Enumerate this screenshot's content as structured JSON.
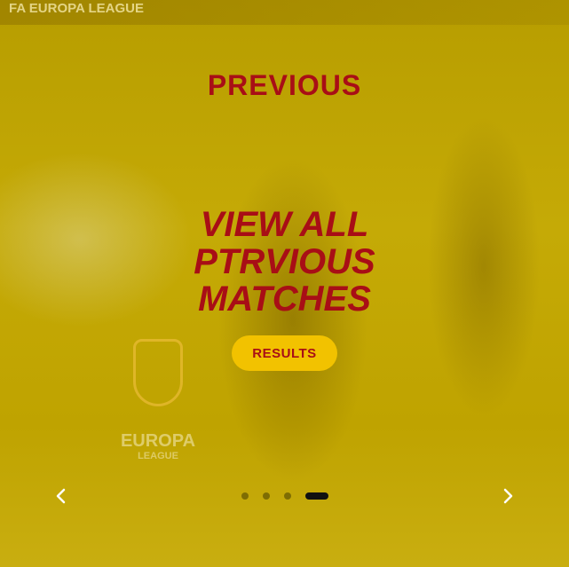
{
  "banner": {
    "text": "FA EUROPA LEAGUE"
  },
  "logo": {
    "word": "EUROPA",
    "sub": "LEAGUE"
  },
  "section": {
    "title": "PREVIOUS"
  },
  "headline": {
    "line1": "VIEW ALL",
    "line2": "PTRVIOUS",
    "line3": "MATCHES"
  },
  "cta": {
    "label": "RESULTS"
  },
  "carousel": {
    "slides": 4,
    "active_index": 3
  },
  "colors": {
    "accent": "#a80e16",
    "button": "#f2c200",
    "overlay": "#c5aa06"
  }
}
